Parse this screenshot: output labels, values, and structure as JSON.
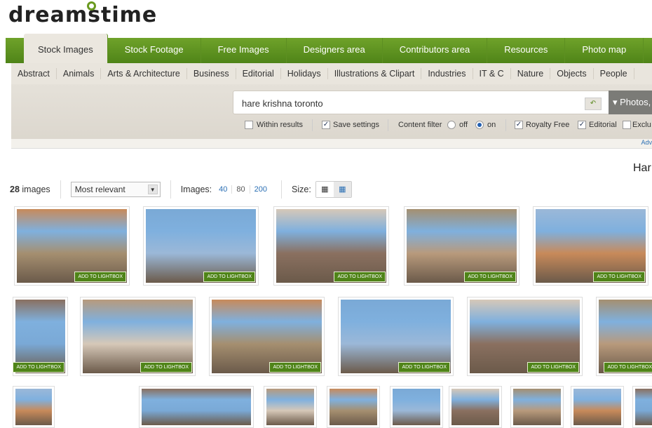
{
  "logo": "dreamstime",
  "top_nav": [
    "Stock Images",
    "Stock Footage",
    "Free Images",
    "Designers area",
    "Contributors area",
    "Resources",
    "Photo map"
  ],
  "categories": [
    "Abstract",
    "Animals",
    "Arts & Architecture",
    "Business",
    "Editorial",
    "Holidays",
    "Illustrations & Clipart",
    "Industries",
    "IT & C",
    "Nature",
    "Objects",
    "People"
  ],
  "search": {
    "value": "hare krishna toronto",
    "type": "Photos,"
  },
  "options": {
    "within": "Within results",
    "save": "Save settings",
    "filter": "Content filter",
    "off": "off",
    "on": "on",
    "royalty": "Royalty Free",
    "editorial": "Editorial",
    "excl": "Exclu"
  },
  "adv": "Adv",
  "heading": "Har",
  "results": {
    "count": "28",
    "count_label": "images",
    "sort": "Most relevant",
    "images_label": "Images:",
    "per_page": [
      "40",
      "80",
      "200"
    ],
    "size_label": "Size:"
  },
  "lightbox_label": "ADD TO LIGHTBOX",
  "colors": {
    "green": "#5a8e1e",
    "link": "#2a6fb4"
  }
}
